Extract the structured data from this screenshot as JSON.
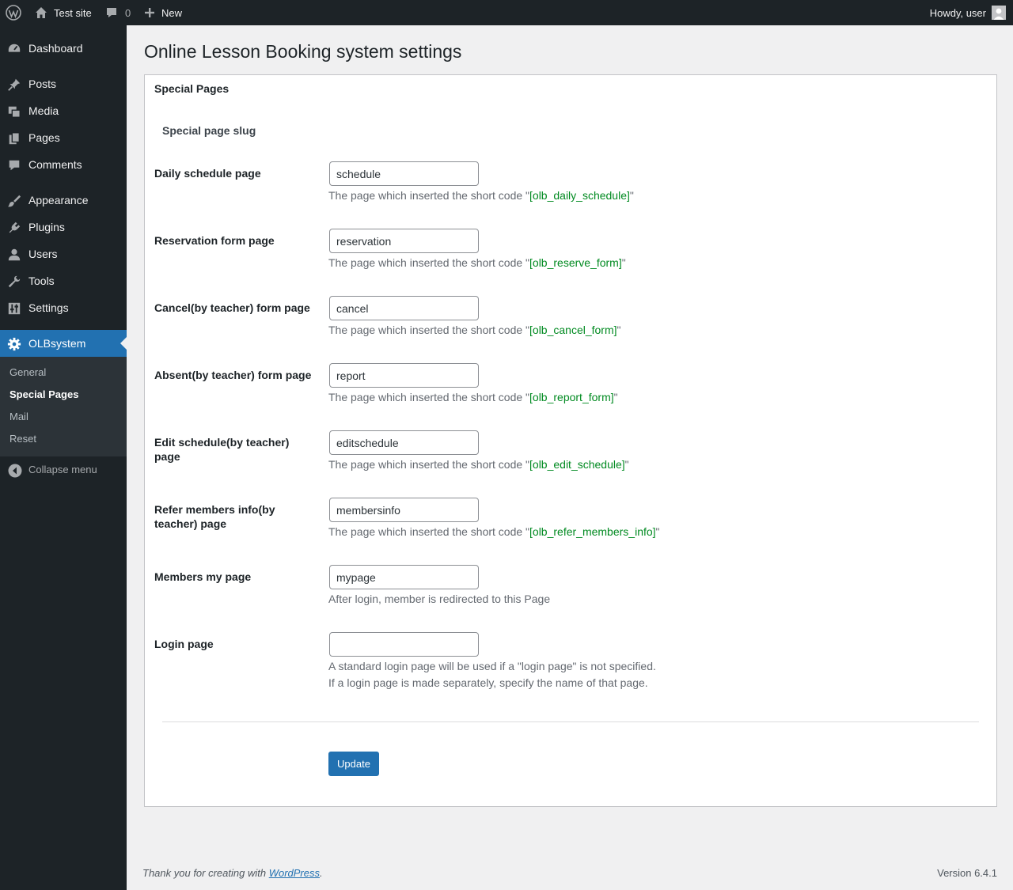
{
  "admin_bar": {
    "site_name": "Test site",
    "comments_count": "0",
    "new_label": "New",
    "howdy": "Howdy, user"
  },
  "sidebar": {
    "items": [
      {
        "label": "Dashboard",
        "icon": "dashboard-icon"
      },
      {
        "label": "Posts",
        "icon": "pin-icon"
      },
      {
        "label": "Media",
        "icon": "media-icon"
      },
      {
        "label": "Pages",
        "icon": "pages-icon"
      },
      {
        "label": "Comments",
        "icon": "comment-icon"
      },
      {
        "label": "Appearance",
        "icon": "brush-icon"
      },
      {
        "label": "Plugins",
        "icon": "plugin-icon"
      },
      {
        "label": "Users",
        "icon": "user-icon"
      },
      {
        "label": "Tools",
        "icon": "wrench-icon"
      },
      {
        "label": "Settings",
        "icon": "settings-icon"
      },
      {
        "label": "OLBsystem",
        "icon": "gear-icon"
      }
    ],
    "submenu": [
      "General",
      "Special Pages",
      "Mail",
      "Reset"
    ],
    "collapse_label": "Collapse menu"
  },
  "page": {
    "title": "Online Lesson Booking system settings",
    "panel_heading": "Special Pages",
    "section_label": "Special page slug",
    "rows": [
      {
        "label": "Daily schedule page",
        "value": "schedule",
        "desc_prefix": "The page which inserted the short code \"",
        "code": "[olb_daily_schedule]",
        "desc_suffix": "\""
      },
      {
        "label": "Reservation form page",
        "value": "reservation",
        "desc_prefix": "The page which inserted the short code \"",
        "code": "[olb_reserve_form]",
        "desc_suffix": "\""
      },
      {
        "label": "Cancel(by teacher) form page",
        "value": "cancel",
        "desc_prefix": "The page which inserted the short code \"",
        "code": "[olb_cancel_form]",
        "desc_suffix": "\""
      },
      {
        "label": "Absent(by teacher) form page",
        "value": "report",
        "desc_prefix": "The page which inserted the short code \"",
        "code": "[olb_report_form]",
        "desc_suffix": "\""
      },
      {
        "label": "Edit schedule(by teacher) page",
        "value": "editschedule",
        "desc_prefix": "The page which inserted the short code \"",
        "code": "[olb_edit_schedule]",
        "desc_suffix": "\""
      },
      {
        "label": "Refer members info(by teacher) page",
        "value": "membersinfo",
        "desc_prefix": "The page which inserted the short code \"",
        "code": "[olb_refer_members_info]",
        "desc_suffix": "\""
      },
      {
        "label": "Members my page",
        "value": "mypage",
        "desc": "After login, member is redirected to this Page"
      },
      {
        "label": "Login page",
        "value": "",
        "desc_line1": "A standard login page will be used if a \"login page\" is not specified.",
        "desc_line2": "If a login page is made separately, specify the name of that page."
      }
    ],
    "update_label": "Update"
  },
  "footer": {
    "thanks_prefix": "Thank you for creating with ",
    "wordpress_link": "WordPress",
    "thanks_suffix": ".",
    "version": "Version 6.4.1"
  },
  "colors": {
    "admin_bg": "#1d2327",
    "accent": "#2271b1",
    "submenu_bg": "#2c3338",
    "shortcode_green": "#008a20"
  }
}
